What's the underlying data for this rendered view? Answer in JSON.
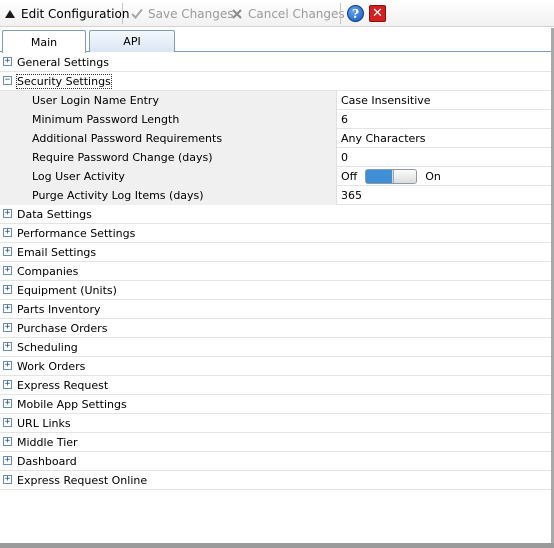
{
  "toolbar": {
    "edit_label": "Edit Configuration",
    "save_label": "Save Changes",
    "cancel_label": "Cancel Changes",
    "help_glyph": "?",
    "close_glyph": "✕"
  },
  "tabs": [
    {
      "label": "Main",
      "selected": true
    },
    {
      "label": "API",
      "selected": false
    }
  ],
  "tree": {
    "categories_before": [
      {
        "label": "General Settings",
        "expanded": false
      }
    ],
    "security": {
      "label": "Security Settings",
      "expanded": true,
      "properties": [
        {
          "name": "User Login Name Entry",
          "value": "Case Insensitive"
        },
        {
          "name": "Minimum Password Length",
          "value": "6"
        },
        {
          "name": "Additional Password Requirements",
          "value": "Any Characters"
        },
        {
          "name": "Require Password Change (days)",
          "value": "0"
        },
        {
          "name": "Log User Activity",
          "toggle_off": "Off",
          "toggle_on": "On",
          "toggle_state": "off"
        },
        {
          "name": "Purge Activity Log Items (days)",
          "value": "365"
        }
      ]
    },
    "categories_after": [
      {
        "label": "Data Settings"
      },
      {
        "label": "Performance Settings"
      },
      {
        "label": "Email Settings"
      },
      {
        "label": "Companies"
      },
      {
        "label": "Equipment (Units)"
      },
      {
        "label": "Parts Inventory"
      },
      {
        "label": "Purchase Orders"
      },
      {
        "label": "Scheduling"
      },
      {
        "label": "Work Orders"
      },
      {
        "label": "Express Request"
      },
      {
        "label": "Mobile App Settings"
      },
      {
        "label": "URL Links"
      },
      {
        "label": "Middle Tier"
      },
      {
        "label": "Dashboard"
      },
      {
        "label": "Express Request Online"
      }
    ],
    "expand_glyph": "+",
    "collapse_glyph": "−"
  }
}
